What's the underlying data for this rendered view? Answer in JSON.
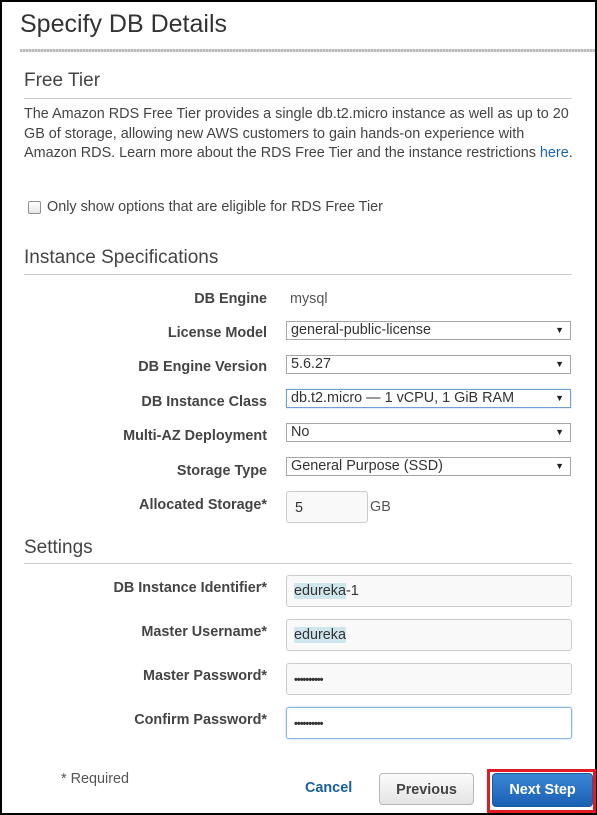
{
  "page": {
    "title": "Specify DB Details"
  },
  "free_tier": {
    "heading": "Free Tier",
    "description": "The Amazon RDS Free Tier provides a single db.t2.micro instance as well as up to 20 GB of storage, allowing new AWS customers to gain hands-on experience with Amazon RDS. Learn more about the RDS Free Tier and the instance restrictions",
    "link_text": "here",
    "trailing": ".",
    "checkbox_label": "Only show options that are eligible for RDS Free Tier",
    "checkbox_checked": false
  },
  "instance_specs": {
    "heading": "Instance Specifications",
    "db_engine_label": "DB Engine",
    "db_engine_value": "mysql",
    "license_model_label": "License Model",
    "license_model_value": "general-public-license",
    "engine_version_label": "DB Engine Version",
    "engine_version_value": "5.6.27",
    "instance_class_label": "DB Instance Class",
    "instance_class_value": "db.t2.micro — 1 vCPU, 1 GiB RAM",
    "multi_az_label": "Multi-AZ Deployment",
    "multi_az_value": "No",
    "storage_type_label": "Storage Type",
    "storage_type_value": "General Purpose (SSD)",
    "allocated_storage_label": "Allocated Storage*",
    "allocated_storage_value": "5",
    "allocated_storage_unit": "GB",
    "dropdown_arrow": "▼"
  },
  "settings": {
    "heading": "Settings",
    "identifier_label": "DB Instance Identifier*",
    "identifier_value_highlight": "edureka",
    "identifier_value_rest": "-1",
    "username_label": "Master Username*",
    "username_value": "edureka",
    "password_label": "Master Password*",
    "password_value": "••••••••••",
    "confirm_label": "Confirm Password*",
    "confirm_value": "••••••••••"
  },
  "footer": {
    "required_note": "* Required",
    "cancel_label": "Cancel",
    "previous_label": "Previous",
    "next_label": "Next Step"
  },
  "colors": {
    "link": "#1a66b2",
    "primary_button": "#1a60b5",
    "highlight_box": "#e21b23"
  }
}
